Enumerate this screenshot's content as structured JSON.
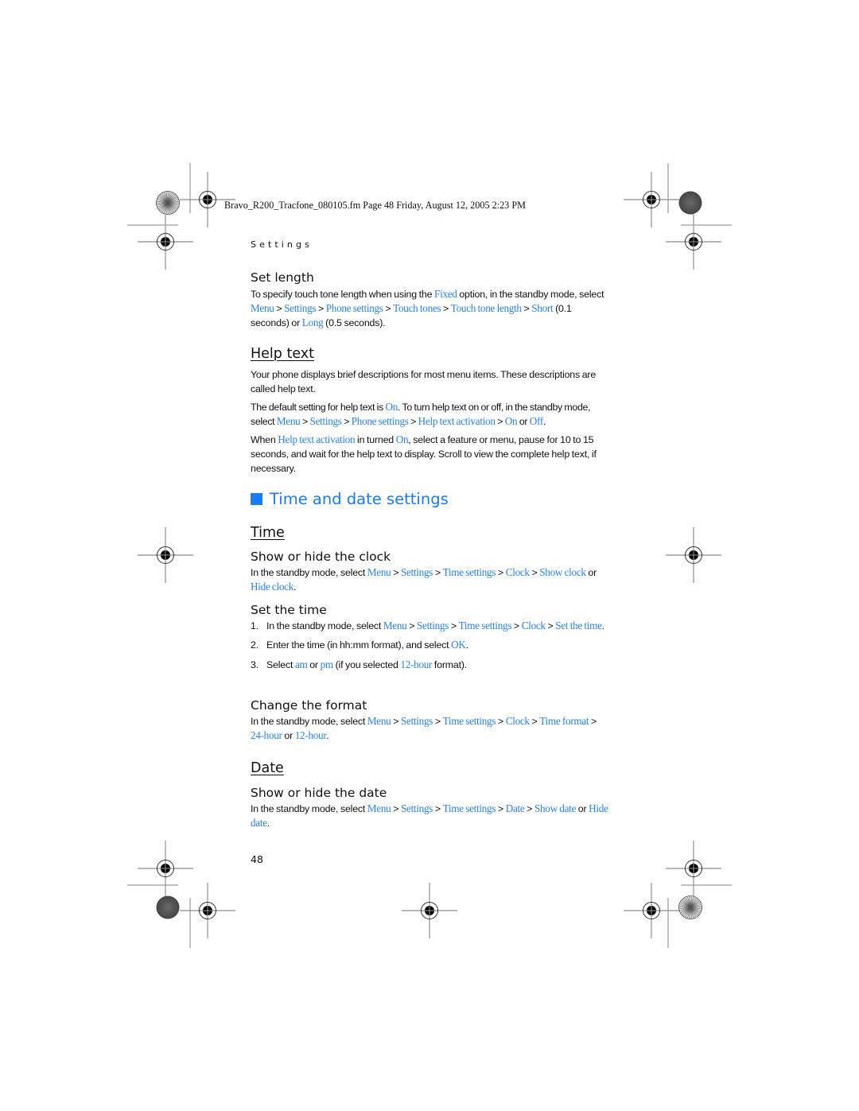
{
  "file_header": "Bravo_R200_Tracfone_080105.fm  Page 48  Friday, August 12, 2005  2:23 PM",
  "running_head": "Settings",
  "sections": {
    "set_length": {
      "heading": "Set length",
      "p1": {
        "t1": "To specify touch tone length when using the ",
        "l1": "Fixed",
        "t2": " option, in the standby mode, select ",
        "l2": "Menu",
        "t3": " > ",
        "l3": "Settings",
        "t4": " > ",
        "l4": "Phone settings",
        "t5": " > ",
        "l5": "Touch tones",
        "t6": " > ",
        "l6": "Touch tone length",
        "t7": " > ",
        "l7": "Short",
        "t8": " (0.1 seconds) or ",
        "l8": "Long",
        "t9": " (0.5 seconds)."
      }
    },
    "help_text": {
      "heading": "Help text",
      "p1": "Your phone displays brief descriptions for most menu items. These descriptions are called help text.",
      "p2": {
        "t1": "The default setting for help text is ",
        "l1": "On",
        "t2": ". To turn help text on or off, in the standby mode, select ",
        "l2": "Menu",
        "t3": " > ",
        "l3": "Settings",
        "t4": " > ",
        "l4": "Phone settings",
        "t5": " > ",
        "l5": "Help text activation",
        "t6": " > ",
        "l6": "On",
        "t7": " or ",
        "l7": "Off",
        "t8": "."
      },
      "p3": {
        "t1": "When ",
        "l1": "Help text activation",
        "t2": " in turned ",
        "l2": "On",
        "t3": ", select a feature or menu, pause for 10 to 15 seconds, and wait for the help text to display. Scroll to view the complete help text, if necessary."
      }
    },
    "time_date": {
      "heading": "Time and date settings",
      "time": {
        "heading": "Time",
        "show_hide_clock": {
          "heading": "Show or hide the clock",
          "p": {
            "t1": "In the standby mode, select ",
            "l1": "Menu",
            "t2": " > ",
            "l2": "Settings",
            "t3": " > ",
            "l3": "Time settings",
            "t4": " > ",
            "l4": "Clock",
            "t5": " > ",
            "l5": "Show clock",
            "t6": " or ",
            "l6": "Hide clock",
            "t7": "."
          }
        },
        "set_time": {
          "heading": "Set the time",
          "steps": [
            {
              "num": "1.",
              "t1": "In the standby mode, select ",
              "l1": "Menu",
              "t2": " > ",
              "l2": "Settings",
              "t3": " > ",
              "l3": "Time settings",
              "t4": " > ",
              "l4": "Clock",
              "t5": " > ",
              "l5": "Set the time",
              "t6": "."
            },
            {
              "num": "2.",
              "t1": "Enter the time (in hh:mm format), and select ",
              "l1": "OK",
              "t2": "."
            },
            {
              "num": "3.",
              "t1": "Select ",
              "l1": "am",
              "t2": " or ",
              "l2": "pm",
              "t3": " (if you selected ",
              "l3": "12-hour",
              "t4": " format)."
            }
          ]
        },
        "change_format": {
          "heading": "Change the format",
          "p": {
            "t1": "In the standby mode, select ",
            "l1": "Menu",
            "t2": " > ",
            "l2": "Settings",
            "t3": " > ",
            "l3": "Time settings",
            "t4": " > ",
            "l4": "Clock",
            "t5": " > ",
            "l5": "Time format",
            "t6": " > ",
            "l6": "24-hour",
            "t7": " or ",
            "l7": "12-hour",
            "t8": "."
          }
        }
      },
      "date": {
        "heading": "Date",
        "show_hide_date": {
          "heading": "Show or hide the date",
          "p": {
            "t1": "In the standby mode, select ",
            "l1": "Menu",
            "t2": " > ",
            "l2": "Settings",
            "t3": " > ",
            "l3": "Time settings",
            "t4": " > ",
            "l4": "Date",
            "t5": " > ",
            "l5": "Show date",
            "t6": " or ",
            "l6": "Hide date",
            "t7": "."
          }
        }
      }
    }
  },
  "page_number": "48",
  "colors": {
    "accent_blue": "#1a7cf5",
    "link_blue": "#2a82f0",
    "text": "#111111",
    "registration_gray": "#999999"
  }
}
